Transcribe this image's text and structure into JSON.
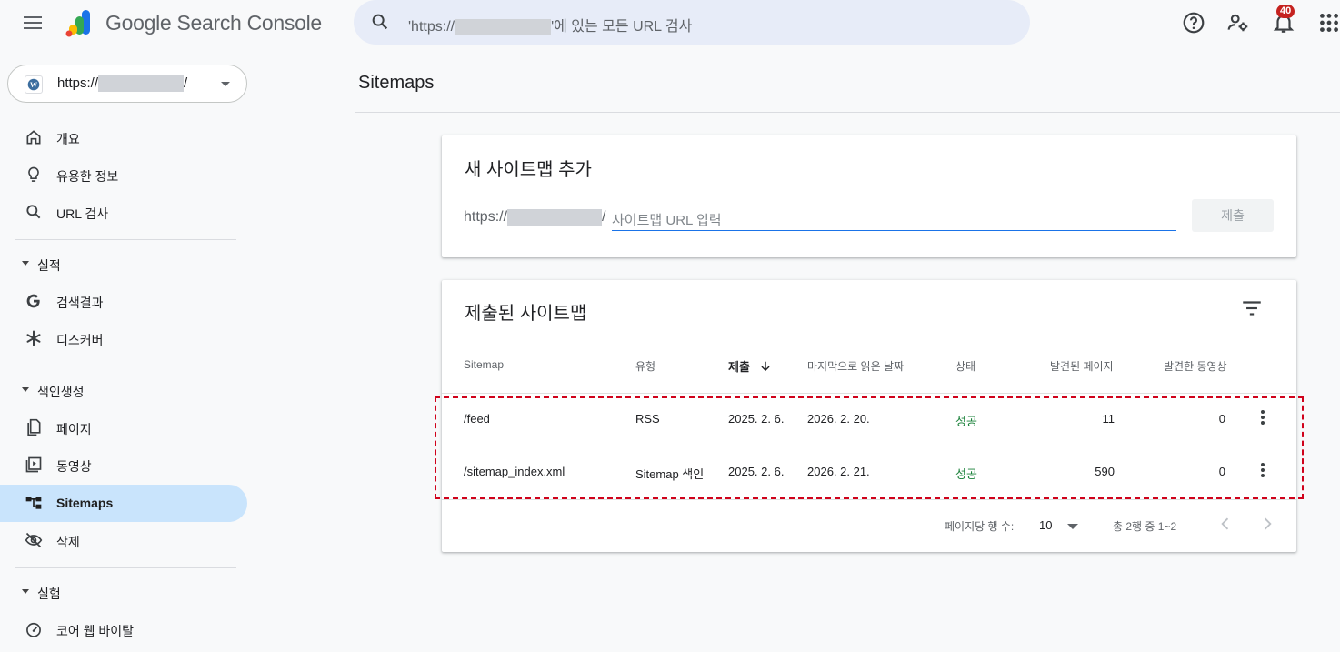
{
  "header": {
    "app_title": "Google Search Console",
    "search_prefix": "'https://",
    "search_suffix": "'에 있는 모든 URL 검사",
    "notification_count": "40",
    "icons": [
      "menu-icon",
      "help-icon",
      "manage-users-icon",
      "bell-icon",
      "apps-grid-icon"
    ]
  },
  "property": {
    "prefix": "https://",
    "suffix": "/"
  },
  "sidebar": {
    "items_top": [
      {
        "label": "개요",
        "icon": "home-icon"
      },
      {
        "label": "유용한 정보",
        "icon": "lightbulb-icon"
      },
      {
        "label": "URL 검사",
        "icon": "search-icon"
      }
    ],
    "section_performance": "실적",
    "items_performance": [
      {
        "label": "검색결과",
        "icon": "google-g-icon"
      },
      {
        "label": "디스커버",
        "icon": "asterisk-icon"
      }
    ],
    "section_indexing": "색인생성",
    "items_indexing": [
      {
        "label": "페이지",
        "icon": "pages-icon"
      },
      {
        "label": "동영상",
        "icon": "video-icon"
      },
      {
        "label": "Sitemaps",
        "icon": "sitemap-icon",
        "active": true
      },
      {
        "label": "삭제",
        "icon": "eye-off-icon"
      }
    ],
    "section_experience": "실험",
    "items_experience": [
      {
        "label": "코어 웹 바이탈",
        "icon": "gauge-icon"
      }
    ]
  },
  "main": {
    "page_title": "Sitemaps",
    "add_card": {
      "title": "새 사이트맵 추가",
      "prefix": "https://",
      "prefix_tail": "/",
      "placeholder": "사이트맵 URL 입력",
      "submit_label": "제출"
    },
    "submitted_card": {
      "title": "제출된 사이트맵",
      "columns": [
        "Sitemap",
        "유형",
        "제출",
        "마지막으로 읽은 날짜",
        "상태",
        "발견된 페이지",
        "발견한 동영상"
      ],
      "sorted_column": "제출",
      "rows": [
        {
          "sitemap": "/feed",
          "type": "RSS",
          "submitted": "2025. 2. 6.",
          "last_read": "2026. 2. 20.",
          "status": "성공",
          "pages": "11",
          "videos": "0"
        },
        {
          "sitemap": "/sitemap_index.xml",
          "type": "Sitemap 색인",
          "submitted": "2025. 2. 6.",
          "last_read": "2026. 2. 21.",
          "status": "성공",
          "pages": "590",
          "videos": "0"
        }
      ],
      "pagination": {
        "rows_per_page_label": "페이지당 행 수:",
        "rows_per_page_value": "10",
        "range_label": "총 2행 중 1~2"
      }
    }
  },
  "colors": {
    "accent": "#1a73e8",
    "active_nav": "#c9e4fc",
    "success": "#188038",
    "highlight": "#d0021b"
  }
}
